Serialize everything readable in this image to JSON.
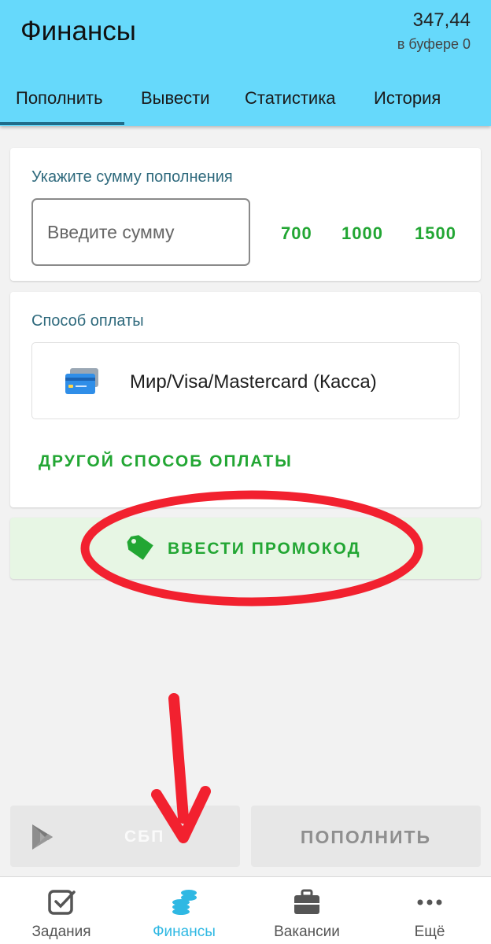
{
  "header": {
    "title": "Финансы",
    "balance": "347,44",
    "buffer_text": "в буфере 0",
    "background_color": "#66d9fb"
  },
  "tabs": [
    {
      "label": "Пополнить",
      "active": true
    },
    {
      "label": "Вывести",
      "active": false
    },
    {
      "label": "Статистика",
      "active": false
    },
    {
      "label": "История",
      "active": false
    }
  ],
  "amount_card": {
    "label": "Укажите сумму пополнения",
    "input_placeholder": "Введите сумму",
    "input_value": "",
    "quick_amounts": [
      "700",
      "1000",
      "1500"
    ]
  },
  "payment_card": {
    "label": "Способ оплаты",
    "selected_method": "Мир/Visa/Mastercard (Касса)",
    "method_icon": "credit-card-icon",
    "other_method_label": "ДРУГОЙ СПОСОБ ОПЛАТЫ"
  },
  "promo": {
    "label": "ВВЕСТИ ПРОМОКОД",
    "icon": "tag-icon"
  },
  "buttons": {
    "sbp_label": "СБП",
    "sbp_icon": "sbp-logo-icon",
    "topup_label": "ПОПОЛНИТЬ"
  },
  "bottom_nav": [
    {
      "label": "Задания",
      "icon": "checkbox-icon",
      "active": false
    },
    {
      "label": "Финансы",
      "icon": "coins-icon",
      "active": true
    },
    {
      "label": "Вакансии",
      "icon": "briefcase-icon",
      "active": false
    },
    {
      "label": "Ещё",
      "icon": "more-dots-icon",
      "active": false
    }
  ],
  "colors": {
    "accent_green": "#22a633",
    "active_nav": "#2fb8e3",
    "annotation_red": "#f2212f"
  }
}
